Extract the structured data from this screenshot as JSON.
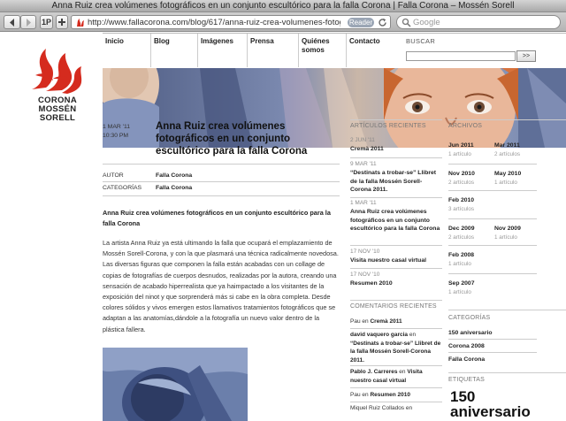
{
  "browser": {
    "window_title": "Anna Ruiz crea volúmenes fotográficos en un conjunto escultórico para la falla Corona | Falla Corona – Mossén Sorell",
    "url": "http://www.fallacorona.com/blog/617/anna-ruiz-crea-volumenes-fotograficos-en",
    "reader_label": "Reader",
    "search_placeholder": "Google",
    "bookmarks_label": "1P"
  },
  "logo": {
    "line1": "CORONA",
    "line2": "MOSSÉN SORELL",
    "brand_color": "#d52b1e"
  },
  "nav": {
    "items": [
      "Inicio",
      "Blog",
      "Imágenes",
      "Prensa",
      "Quiénes somos",
      "Contacto"
    ],
    "search_label": "BUSCAR",
    "search_button": ">>"
  },
  "post": {
    "date": "1 MAR '11",
    "time": "10:30 PM",
    "title": "Anna Ruiz crea volúmenes fotográficos en un conjunto escultórico para la falla Corona",
    "author_label": "AUTOR",
    "author": "Falla Corona",
    "categories_label": "CATEGORÍAS",
    "category": "Falla Corona",
    "lead": "Anna Ruiz crea volúmenes fotográficos en un conjunto escultórico para la falla Corona",
    "body": "La artista Anna Ruiz ya está ultimando la falla que ocupará el emplazamiento de Mossén Sorell-Corona, y con la que plasmará una técnica radicalmente novedosa. Las diversas figuras que componen la falla están acabadas con un collage de copias de fotografías de cuerpos desnudos, realizadas por la autora, creando una sensación de acabado hiperrealista que ya haimpactado a los visitantes de la exposición del ninot y que sorprenderá más si cabe en la obra completa. Desde colores sólidos y vivos emergen estos llamativos tratamientos fotográficos que se adaptan a las anatomías,dándole a la fotografía un nuevo valor dentro de la plástica fallera."
  },
  "recent_articles": {
    "heading": "ARTÍCULOS RECIENTES",
    "items": [
      {
        "date": "2 JUN '11",
        "title": "Cremà 2011"
      },
      {
        "date": "9 MAR '11",
        "title": "“Destinats a trobar-se” Llibret de la falla Mossén Sorell-Corona 2011."
      },
      {
        "date": "1 MAR '11",
        "title": "Anna Ruiz crea volúmenes fotográficos en un conjunto escultórico para la falla Corona"
      },
      {
        "date": "17 NOV '10",
        "title": "Visita nuestro casal virtual"
      },
      {
        "date": "17 NOV '10",
        "title": "Resumen 2010"
      }
    ]
  },
  "recent_comments": {
    "heading": "COMENTARIOS RECIENTES",
    "items": [
      {
        "author": "Pau",
        "connector": "en",
        "post": "Cremà 2011"
      },
      {
        "author": "david vaquero garcia",
        "connector": "en",
        "post": "“Destinats a trobar-se” Llibret de la falla Mossén Sorell-Corona 2011."
      },
      {
        "author": "Pablo J. Carreres",
        "connector": "en",
        "post": "Visita nuestro casal virtual"
      },
      {
        "author": "Pau",
        "connector": "en",
        "post": "Resumen 2010"
      },
      {
        "author": "Miquel Ruiz Collados",
        "connector": "en",
        "post": ""
      }
    ]
  },
  "archives": {
    "heading": "ARCHIVOS",
    "items": [
      {
        "month": "Jun 2011",
        "count": "1 artículo"
      },
      {
        "month": "Mar 2011",
        "count": "2 artículos"
      },
      {
        "month": "Nov 2010",
        "count": "2 artículos"
      },
      {
        "month": "May 2010",
        "count": "1 artículo"
      },
      {
        "month": "Feb 2010",
        "count": "3 artículos"
      },
      {
        "month": "Dec 2009",
        "count": "2 artículos"
      },
      {
        "month": "Nov 2009",
        "count": "1 artículo"
      },
      {
        "month": "Feb 2008",
        "count": "1 artículo"
      },
      {
        "month": "Sep 2007",
        "count": "1 artículo"
      }
    ]
  },
  "categories": {
    "heading": "CATEGORÍAS",
    "items": [
      "150 aniversario",
      "Corona 2008",
      "Falla Corona"
    ]
  },
  "tags": {
    "heading": "ETIQUETAS",
    "big_tag_line1": "150",
    "big_tag_line2": "aniversario"
  }
}
